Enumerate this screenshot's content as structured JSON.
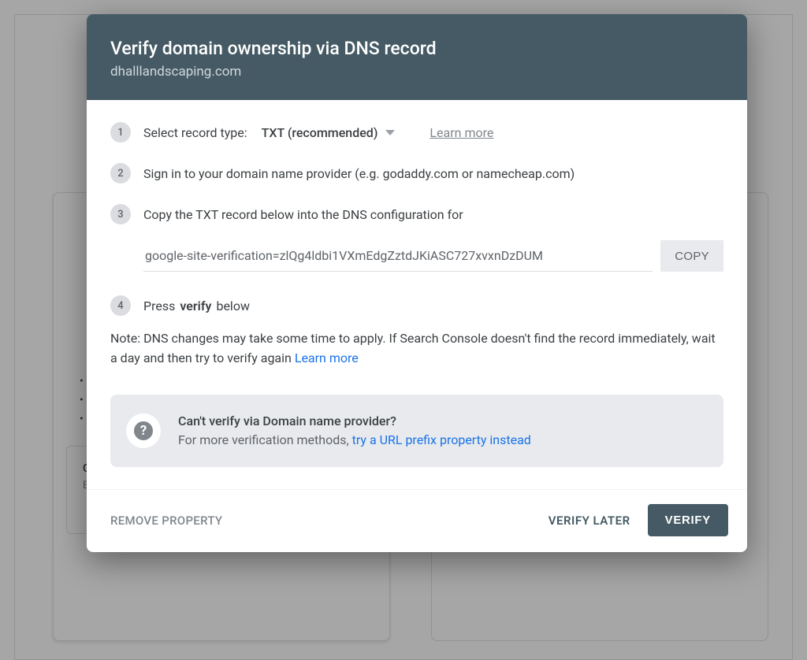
{
  "header": {
    "title": "Verify domain ownership via DNS record",
    "domain": "dhalllandscaping.com"
  },
  "steps": {
    "s1": {
      "num": "1",
      "label": "Select record type:",
      "dropdown_value": "TXT (recommended)",
      "learn_more": "Learn more"
    },
    "s2": {
      "num": "2",
      "text": "Sign in to your domain name provider (e.g. godaddy.com or namecheap.com)"
    },
    "s3": {
      "num": "3",
      "text": "Copy the TXT record below into the DNS configuration for ",
      "record_value": "google-site-verification=zlQg4ldbi1VXmEdgZztdJKiASC727xvxnDzDUM",
      "copy_label": "COPY"
    },
    "s4": {
      "num": "4",
      "pre": "Press ",
      "bold": "verify",
      "post": " below"
    }
  },
  "note": {
    "text": "Note: DNS changes may take some time to apply. If Search Console doesn't find the record immediately, wait a day and then try to verify again ",
    "learn_more": "Learn more"
  },
  "alt": {
    "title": "Can't verify via Domain name provider?",
    "sub_pre": "For more verification methods, ",
    "sub_link": "try a URL prefix property instead"
  },
  "footer": {
    "remove": "REMOVE PROPERTY",
    "verify_later": "VERIFY LATER",
    "verify": "VERIFY"
  }
}
